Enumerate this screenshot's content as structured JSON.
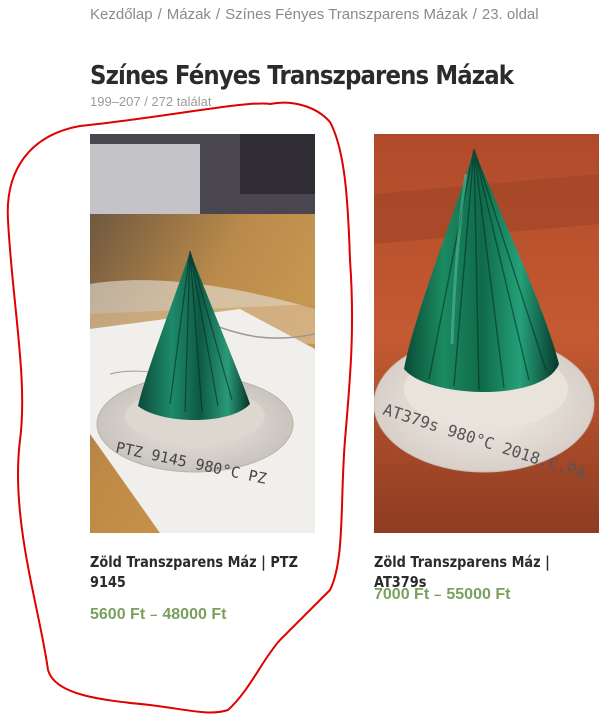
{
  "breadcrumb": {
    "items": [
      "Kezdőlap",
      "Mázak",
      "Színes Fényes Transzparens Mázak"
    ],
    "separator": "/",
    "current": "23. oldal"
  },
  "page": {
    "title": "Színes Fényes Transzparens Mázak",
    "result_count": "199–207 / 272 találat"
  },
  "products": [
    {
      "name": "Zöld Transzparens Máz | PTZ 9145",
      "price_min": "5600 Ft",
      "price_sep": "–",
      "price_max": "48000 Ft",
      "image_text": "PTZ 9145  980°C PZ"
    },
    {
      "name": "Zöld Transzparens Máz | AT379s",
      "price_min": "7000 Ft",
      "price_sep": "–",
      "price_max": "55000 Ft",
      "image_text": "AT379s  980°C  2018.C.PA"
    }
  ],
  "colors": {
    "price": "#7aa05e",
    "annotation": "#e00000"
  }
}
